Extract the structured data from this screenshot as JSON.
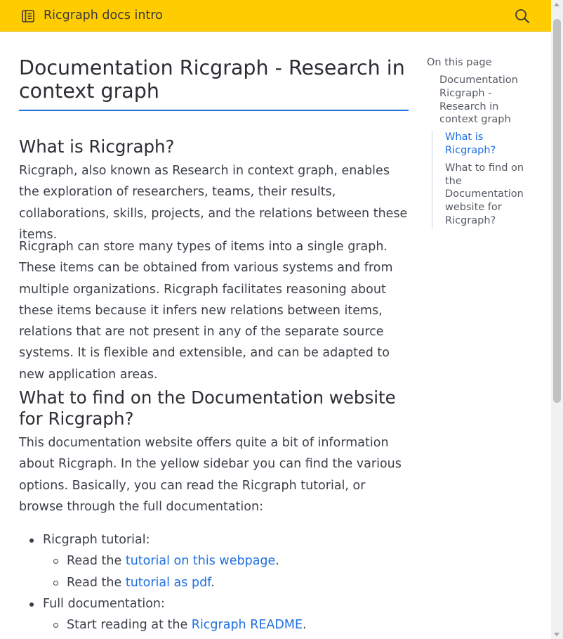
{
  "header": {
    "title": "Ricgraph docs intro",
    "menu_icon": "book-icon",
    "search_icon": "search-icon",
    "background_color": "#ffcc00"
  },
  "main": {
    "h1": "Documentation Ricgraph - Research in context graph",
    "section1": {
      "heading": "What is Ricgraph?",
      "p1": "Ricgraph, also known as Research in context graph, enables the exploration of researchers, teams, their results, collaborations, skills, projects, and the relations between these items.",
      "p2": "Ricgraph can store many types of items into a single graph. These items can be obtained from various systems and from multiple organizations. Ricgraph facilitates reasoning about these items because it infers new relations between items, relations that are not present in any of the separate source systems. It is flexible and extensible, and can be adapted to new application areas."
    },
    "section2": {
      "heading": "What to find on the Documentation website for Ricgraph?",
      "p1": "This documentation website offers quite a bit of information about Ricgraph. In the yellow sidebar you can find the various options. Basically, you can read the Ricgraph tutorial, or browse through the full documentation:",
      "list": {
        "item1": "Ricgraph tutorial:",
        "item1_sub1_prefix": "Read the ",
        "item1_sub1_link": "tutorial on this webpage",
        "item1_sub1_suffix": ".",
        "item1_sub2_prefix": "Read the ",
        "item1_sub2_link": "tutorial as pdf",
        "item1_sub2_suffix": ".",
        "item2": "Full documentation:",
        "item2_sub1_prefix": "Start reading at the ",
        "item2_sub1_link": "Ricgraph README",
        "item2_sub1_suffix": "."
      }
    }
  },
  "toc": {
    "title": "On this page",
    "items": [
      "Documentation Ricgraph - Research in context graph",
      "What is Ricgraph?",
      "What to find on the Documentation website for Ricgraph?"
    ],
    "active_index": 1
  },
  "colors": {
    "accent": "#1e6fe0",
    "text": "#3a3f47"
  }
}
